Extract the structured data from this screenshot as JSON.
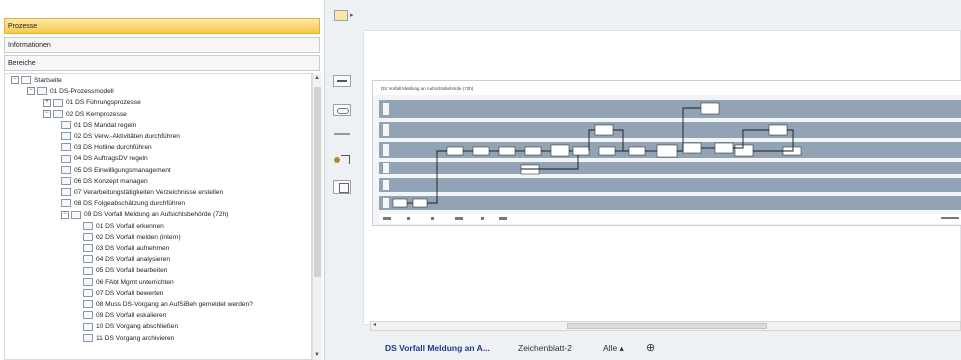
{
  "sidebar": {
    "sections": [
      "Prozesse",
      "Informationen",
      "Bereiche"
    ],
    "tree": [
      {
        "label": "Startseite",
        "level": 0,
        "expander": "−"
      },
      {
        "label": "01 DS-Prozessmodell",
        "level": 1,
        "expander": "−"
      },
      {
        "label": "01 DS Führungsprozesse",
        "level": 2,
        "expander": "+"
      },
      {
        "label": "02 DS Kernprozesse",
        "level": 2,
        "expander": "−"
      },
      {
        "label": "01 DS Mandat regeln",
        "level": 3,
        "expander": ""
      },
      {
        "label": "02 DS Verw.-Aktivitäten durchführen",
        "level": 3,
        "expander": ""
      },
      {
        "label": "03 DS Hotline durchführen",
        "level": 3,
        "expander": ""
      },
      {
        "label": "04 DS AuftragsDV regeln",
        "level": 3,
        "expander": ""
      },
      {
        "label": "05 DS Einwilligungsmanagement",
        "level": 3,
        "expander": ""
      },
      {
        "label": "06 DS Konzept managen",
        "level": 3,
        "expander": ""
      },
      {
        "label": "07 Verarbeitungstätigkeiten Verzeichnisse erstellen",
        "level": 3,
        "expander": ""
      },
      {
        "label": "08 DS Folgeabschätzung durchführen",
        "level": 3,
        "expander": ""
      },
      {
        "label": "09 DS Vorfall Meldung an Aufsichtsbehörde (72h)",
        "level": 3,
        "expander": "−"
      },
      {
        "label": "01 DS Vorfall erkennen",
        "level": 4,
        "expander": ""
      },
      {
        "label": "02 DS Vorfall melden (intern)",
        "level": 4,
        "expander": ""
      },
      {
        "label": "03 DS Vorfall aufnehmen",
        "level": 4,
        "expander": ""
      },
      {
        "label": "04 DS Vorfall analysieren",
        "level": 4,
        "expander": ""
      },
      {
        "label": "05 DS Vorfall bearbeiten",
        "level": 4,
        "expander": ""
      },
      {
        "label": "06 FAbt Mgmt unterrichten",
        "level": 4,
        "expander": ""
      },
      {
        "label": "07 DS Vorfall bewerten",
        "level": 4,
        "expander": ""
      },
      {
        "label": "08 Muss DS-Vorgang an AufSiBeh gemeldet werden?",
        "level": 4,
        "expander": ""
      },
      {
        "label": "09 DS Vorfall eskalieren",
        "level": 4,
        "expander": ""
      },
      {
        "label": "10 DS Vorgang abschließen",
        "level": 4,
        "expander": ""
      },
      {
        "label": "11 DS Vorgang archivieren",
        "level": 4,
        "expander": ""
      }
    ]
  },
  "diagram": {
    "title": "DS Vorfall Meldung an Aufsichtsbehörde (72h)"
  },
  "tabs": {
    "active": "DS Vorfall Meldung an A...",
    "second": "Zeichenblatt-2",
    "all": "Alle ▴",
    "add": "⊕"
  },
  "colors": {
    "active_section": "#f8c84a",
    "lane": "#91a3b5",
    "active_tab_text": "#1f3c8a"
  }
}
